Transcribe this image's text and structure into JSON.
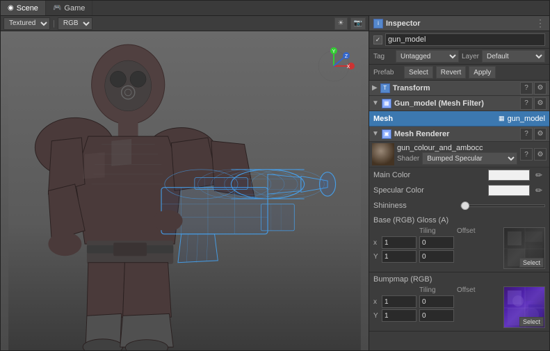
{
  "tabs": {
    "scene": "Scene",
    "game": "Game"
  },
  "viewport": {
    "mode": "Textured",
    "channel": "RGB",
    "toolbar_icons": [
      "sun-icon",
      "camera-icon"
    ]
  },
  "inspector": {
    "title": "Inspector",
    "object_name": "gun_model",
    "tag_label": "Tag",
    "tag_value": "Untagged",
    "layer_label": "Layer",
    "layer_value": "Default",
    "prefab_label": "Prefab",
    "btn_select": "Select",
    "btn_revert": "Revert",
    "btn_apply": "Apply"
  },
  "transform": {
    "name": "Transform",
    "btn_info": "?",
    "btn_settings": "⚙"
  },
  "mesh_filter": {
    "component_name": "Gun_model (Mesh Filter)",
    "mesh_label": "Mesh",
    "mesh_value": "gun_model"
  },
  "mesh_renderer": {
    "name": "Mesh Renderer"
  },
  "material": {
    "name": "gun_colour_and_ambocc",
    "shader_label": "Shader",
    "shader_value": "Bumped Specular"
  },
  "properties": {
    "main_color_label": "Main Color",
    "specular_color_label": "Specular Color",
    "shininess_label": "Shininess",
    "shininess_value": ""
  },
  "base_texture": {
    "title": "Base (RGB) Gloss (A)",
    "tiling_label": "Tiling",
    "offset_label": "Offset",
    "x_label": "x",
    "y_label": "Y",
    "tiling_x": "1",
    "tiling_y": "1",
    "offset_x": "0",
    "offset_y": "0",
    "select_btn": "Select"
  },
  "bump_texture": {
    "title": "Bumpmap (RGB)",
    "tiling_label": "Tiling",
    "offset_label": "Offset",
    "x_label": "x",
    "y_label": "Y",
    "tiling_x": "1",
    "tiling_y": "1",
    "offset_x": "0",
    "offset_y": "0",
    "select_btn": "Select"
  }
}
